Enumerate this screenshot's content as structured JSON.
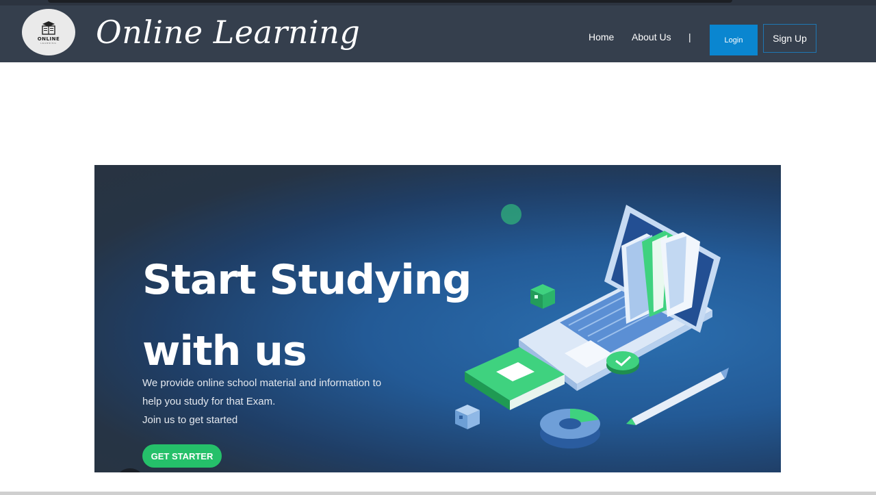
{
  "navbar": {
    "logo": {
      "text": "ONLINE",
      "subtext": "LEARNING"
    },
    "brand_title": "Online Learning",
    "links": [
      {
        "label": "Home"
      },
      {
        "label": "About Us"
      }
    ],
    "separator": "|",
    "login_label": "Login",
    "signup_label": "Sign Up",
    "colors": {
      "bar": "#353f4d",
      "login_bg": "#0a86d0",
      "signup_border": "#1e78b4"
    }
  },
  "hero": {
    "headline_line1": "Start Studying",
    "headline_line2": "with us",
    "description_line1": "We provide online school material and information to",
    "description_line2": "help you study for that Exam.",
    "description_line3": "Join us to get started",
    "cta_label": "GET STARTER",
    "illustration": "laptop-books-icon",
    "colors": {
      "cta": "#25c06a",
      "accent_green": "#2ecc71",
      "background_dark": "#283341",
      "background_blue": "#2b6fb0"
    }
  }
}
